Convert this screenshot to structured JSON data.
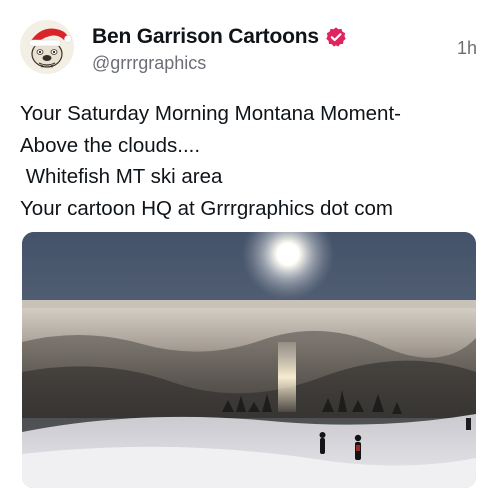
{
  "author": {
    "display_name": "Ben Garrison Cartoons",
    "handle": "@grrrgraphics",
    "verified": true,
    "verified_badge_color": "#e0245e",
    "avatar_icon": "santa-hat-bulldog-avatar"
  },
  "timestamp": "1h",
  "post": {
    "lines": [
      "Your Saturday Morning Montana Moment-",
      "Above the clouds....",
      " Whitefish MT ski area",
      "Your cartoon HQ at Grrrgraphics dot com"
    ]
  },
  "media": {
    "type": "photo",
    "subject": "sun over sea of clouds with skiers on snowy slope"
  },
  "colors": {
    "text": "#0f1419",
    "secondary_text": "#6b6f75",
    "badge": "#e0245e"
  }
}
